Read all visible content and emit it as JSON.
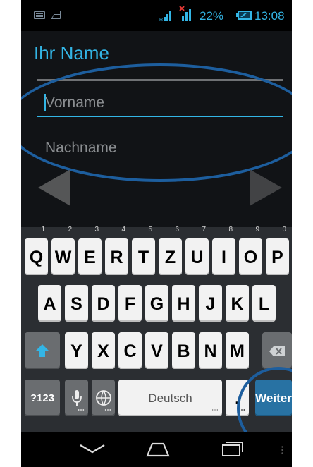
{
  "status_bar": {
    "battery_percent": "22%",
    "time": "13:08",
    "icons": [
      "keyboard-notification-icon",
      "image-notification-icon",
      "signal-roaming-icon",
      "signal-no-sim-icon",
      "battery-icon"
    ]
  },
  "form": {
    "title": "Ihr Name",
    "first_name_placeholder": "Vorname",
    "last_name_placeholder": "Nachname"
  },
  "navigation": {
    "prev": "arrow-left-icon",
    "next": "arrow-right-icon"
  },
  "keyboard": {
    "row1": [
      {
        "label": "Q",
        "hint": "1"
      },
      {
        "label": "W",
        "hint": "2"
      },
      {
        "label": "E",
        "hint": "3"
      },
      {
        "label": "R",
        "hint": "4"
      },
      {
        "label": "T",
        "hint": "5"
      },
      {
        "label": "Z",
        "hint": "6"
      },
      {
        "label": "U",
        "hint": "7"
      },
      {
        "label": "I",
        "hint": "8"
      },
      {
        "label": "O",
        "hint": "9"
      },
      {
        "label": "P",
        "hint": "0"
      }
    ],
    "row2": [
      "A",
      "S",
      "D",
      "F",
      "G",
      "H",
      "J",
      "K",
      "L"
    ],
    "row3": [
      "Y",
      "X",
      "C",
      "V",
      "B",
      "N",
      "M"
    ],
    "symbols_label": "?123",
    "space_label": "Deutsch",
    "period_label": ".",
    "action_label": "Weiter"
  },
  "colors": {
    "accent": "#33b5e5",
    "annotation": "#1d5e9e",
    "action_key": "#2872a3"
  }
}
